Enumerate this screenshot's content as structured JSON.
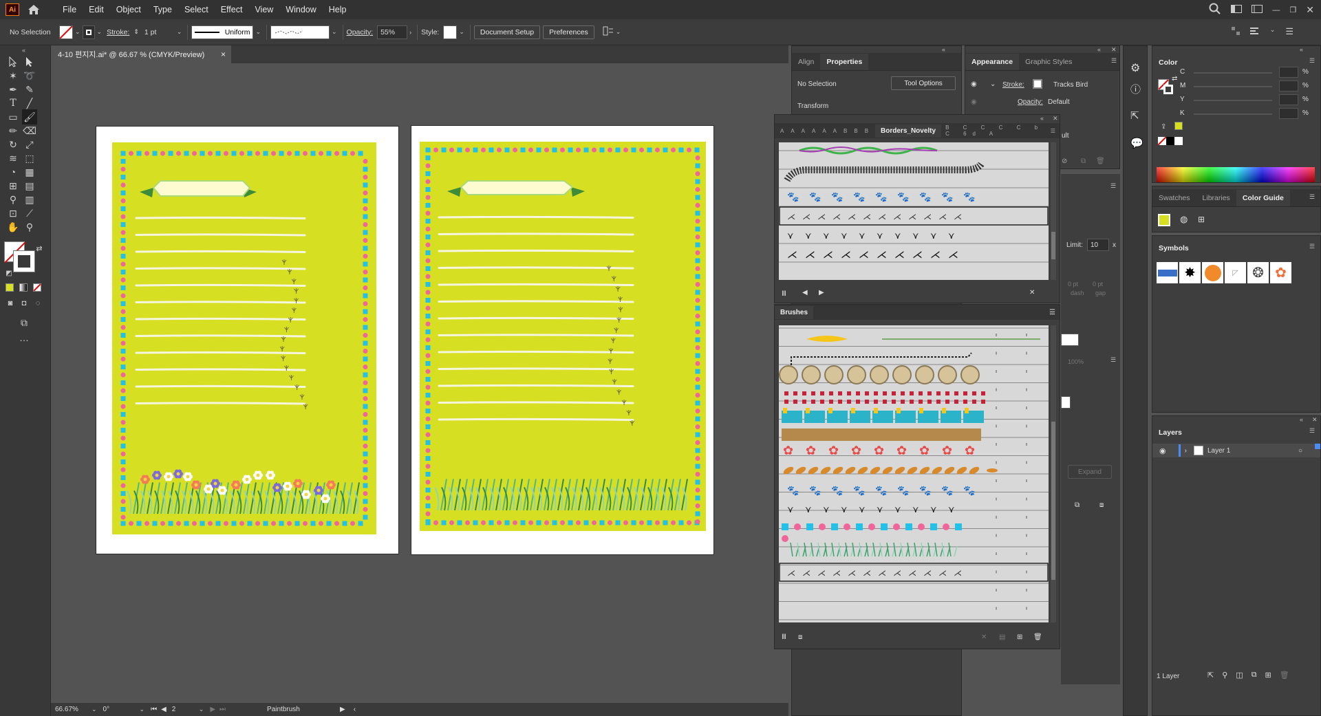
{
  "menubar": {
    "logo": "Ai",
    "items": [
      "File",
      "Edit",
      "Object",
      "Type",
      "Select",
      "Effect",
      "View",
      "Window",
      "Help"
    ]
  },
  "controlbar": {
    "selection": "No Selection",
    "stroke_label": "Stroke:",
    "stroke_weight": "1 pt",
    "profile": "Uniform",
    "opacity_label": "Opacity:",
    "opacity_value": "55%",
    "style_label": "Style:",
    "document_setup": "Document Setup",
    "preferences": "Preferences"
  },
  "document": {
    "tab_title": "4-10 편지지.ai* @ 66.67 % (CMYK/Preview)",
    "close": "×"
  },
  "status": {
    "zoom": "66.67%",
    "rotation": "0°",
    "artboard": "2",
    "tool": "Paintbrush"
  },
  "properties_panel": {
    "tabs": [
      "Align",
      "Properties"
    ],
    "selection": "No Selection",
    "tool_options": "Tool Options",
    "transform": "Transform",
    "limit_label": "Limit:",
    "limit_value": "10",
    "limit_unit": "x",
    "dash_vals": [
      "0 pt",
      "0 pt",
      "dash",
      "gap"
    ],
    "pct": "100%",
    "expand": "Expand"
  },
  "appearance_panel": {
    "tabs": [
      "Appearance",
      "Graphic Styles"
    ],
    "stroke_label": "Stroke:",
    "stroke_value": "Tracks Bird",
    "opacity_label": "Opacity:",
    "opacity_value": "Default",
    "partial": "ult"
  },
  "borders_panel": {
    "title": "Borders_Novelty",
    "left_letters": [
      "A",
      "A",
      "A",
      "A",
      "A",
      "A",
      "B",
      "B",
      "B"
    ],
    "right_letters": [
      "B",
      "C",
      "C",
      "C",
      "C",
      "b",
      "C",
      "6d",
      "A"
    ]
  },
  "brushes_panel": {
    "title": "Brushes"
  },
  "color_panel": {
    "title": "Color",
    "channels": [
      "C",
      "M",
      "Y",
      "K"
    ],
    "unit": "%",
    "colors": {
      "yellow": "#d6df22",
      "pink": "#f0669a",
      "cyan": "#23c0e8"
    }
  },
  "swatches_panel": {
    "tabs": [
      "Swatches",
      "Libraries",
      "Color Guide"
    ]
  },
  "symbols_panel": {
    "title": "Symbols"
  },
  "layers_panel": {
    "title": "Layers",
    "layer_name": "Layer 1",
    "count": "1 Layer"
  }
}
